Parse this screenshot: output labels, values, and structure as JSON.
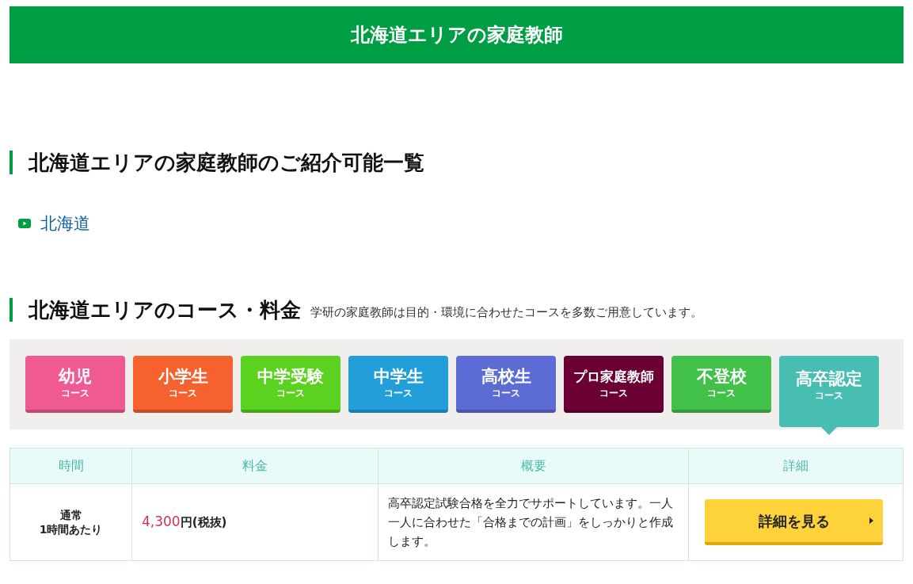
{
  "banner": {
    "title": "北海道エリアの家庭教師"
  },
  "area_section": {
    "heading": "北海道エリアの家庭教師のご紹介可能一覧",
    "links": [
      "北海道"
    ]
  },
  "course_section": {
    "heading": "北海道エリアのコース・料金",
    "subtitle": "学研の家庭教師は目的・環境に合わせたコースを多数ご用意しています。",
    "tabs": [
      {
        "label": "幼児",
        "sub": "コース",
        "color": "#ef5a92",
        "selected": false
      },
      {
        "label": "小学生",
        "sub": "コース",
        "color": "#f5612f",
        "selected": false
      },
      {
        "label": "中学受験",
        "sub": "コース",
        "color": "#5ad21f",
        "selected": false
      },
      {
        "label": "中学生",
        "sub": "コース",
        "color": "#229fd9",
        "selected": false
      },
      {
        "label": "高校生",
        "sub": "コース",
        "color": "#5d6cd4",
        "selected": false
      },
      {
        "label": "プロ家庭教師",
        "sub": "コース",
        "color": "#6a0033",
        "selected": false
      },
      {
        "label": "不登校",
        "sub": "コース",
        "color": "#41c14a",
        "selected": false
      },
      {
        "label": "高卒認定",
        "sub": "コース",
        "color": "#48bdb1",
        "selected": true
      }
    ],
    "table": {
      "columns": [
        "時間",
        "料金",
        "概要",
        "詳細"
      ],
      "rows": [
        {
          "time": [
            "通常",
            "1時間あたり"
          ],
          "price": "4,300",
          "price_unit": "円(税抜)",
          "summary": "高卒認定試験合格を全力でサポートしています。一人一人に合わせた「合格までの計画」をしっかりと作成します。",
          "button": "詳細を見る"
        }
      ]
    }
  }
}
